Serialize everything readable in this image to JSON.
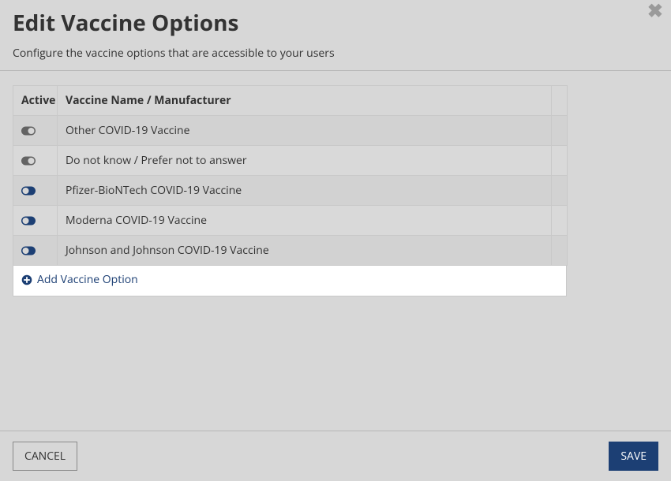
{
  "modal": {
    "title": "Edit Vaccine Options",
    "subtitle": "Configure the vaccine options that are accessible to your users"
  },
  "table": {
    "headers": {
      "active": "Active",
      "name": "Vaccine Name / Manufacturer"
    },
    "rows": [
      {
        "active": false,
        "name": "Other COVID-19 Vaccine"
      },
      {
        "active": false,
        "name": "Do not know / Prefer not to answer"
      },
      {
        "active": true,
        "name": "Pfizer-BioNTech COVID-19 Vaccine"
      },
      {
        "active": true,
        "name": "Moderna COVID-19 Vaccine"
      },
      {
        "active": true,
        "name": "Johnson and Johnson COVID-19 Vaccine"
      }
    ]
  },
  "add_link": "Add Vaccine Option",
  "footer": {
    "cancel": "CANCEL",
    "save": "SAVE"
  },
  "colors": {
    "accent_dark_blue": "#1c3f74",
    "inactive_gray": "#636363"
  }
}
